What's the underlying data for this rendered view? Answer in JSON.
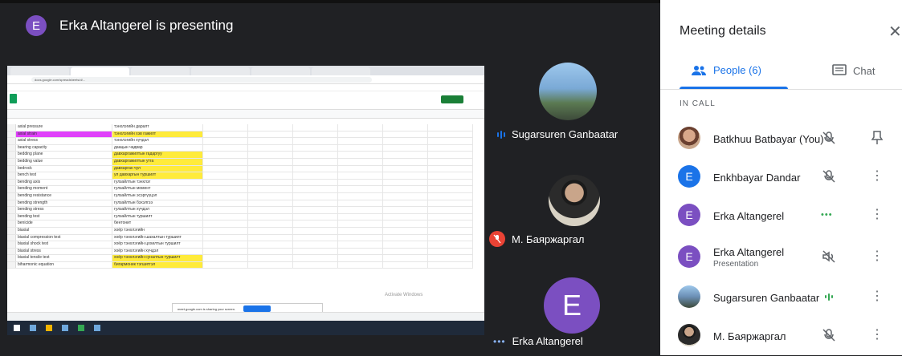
{
  "presenter": {
    "avatar_letter": "E",
    "text": "Erka Altangerel is presenting"
  },
  "tiles": [
    {
      "name": "Sugarsuren Ganbaatar"
    },
    {
      "name": "М. Баяржаргал"
    },
    {
      "name": "Erka Altangerel",
      "avatar_letter": "E"
    }
  ],
  "panel": {
    "title": "Meeting details",
    "tabs": {
      "people": "People (6)",
      "chat": "Chat"
    },
    "section": "IN CALL",
    "participants": [
      {
        "name": "Batkhuu Batbayar (You)",
        "sub": "",
        "avatar": "photo"
      },
      {
        "name": "Enkhbayar Dandar",
        "sub": "",
        "avatar_letter": "E",
        "color": "#1a73e8"
      },
      {
        "name": "Erka Altangerel",
        "sub": "",
        "avatar_letter": "E",
        "color": "#7b4fc1"
      },
      {
        "name": "Erka Altangerel",
        "sub": "Presentation",
        "avatar_letter": "E",
        "color": "#7b4fc1"
      },
      {
        "name": "Sugarsuren Ganbaatar",
        "sub": "",
        "avatar": "photo"
      },
      {
        "name": "М. Баяржаргал",
        "sub": "",
        "avatar": "photo"
      }
    ]
  },
  "shared_screen": {
    "url": "docs.google.com/spreadsheets/d/...",
    "sharebar_text": "meet.google.com is sharing your screen.",
    "rows": [
      {
        "a": "axial pressure",
        "b": "тэнхлэгийн даралт",
        "ya": false,
        "yb": false
      },
      {
        "a": "axial strain",
        "b": "тэнхлэгийн хэв гажилт",
        "ya": true,
        "yb": true
      },
      {
        "a": "axial stress",
        "b": "тэнхлэгийн хүчдэл",
        "ya": false,
        "yb": false
      },
      {
        "a": "bearing capacity",
        "b": "даацын чадвар",
        "ya": false,
        "yb": false
      },
      {
        "a": "bedding plane",
        "b": "давхаргажилтын гадаргуу",
        "ya": false,
        "yb": true
      },
      {
        "a": "bedding value",
        "b": "давхаргажилтын утга",
        "ya": false,
        "yb": true
      },
      {
        "a": "bedrock",
        "b": "давхарган чул",
        "ya": false,
        "yb": true
      },
      {
        "a": "bench test",
        "b": "ул давхаргын туршилт",
        "ya": false,
        "yb": true
      },
      {
        "a": "bending axis",
        "b": "гулзайлтын тэнхлэг",
        "ya": false,
        "yb": false
      },
      {
        "a": "bending moment",
        "b": "гулзайлтын момент",
        "ya": false,
        "yb": false
      },
      {
        "a": "bending resistance",
        "b": "гулзайлтын эсэргүүцэл",
        "ya": false,
        "yb": false
      },
      {
        "a": "bending strength",
        "b": "гулзайлтын бэхэлгээ",
        "ya": false,
        "yb": false
      },
      {
        "a": "bending stress",
        "b": "гулзайлтын хүчдэл",
        "ya": false,
        "yb": false
      },
      {
        "a": "bending test",
        "b": "гулзайлтын туршилт",
        "ya": false,
        "yb": false
      },
      {
        "a": "benicide",
        "b": "бентонит",
        "ya": false,
        "yb": false
      },
      {
        "a": "biaxial",
        "b": "хоёр тэнхлэгийн",
        "ya": false,
        "yb": false
      },
      {
        "a": "biaxial compression test",
        "b": "хоёр тэнхлэгийн шахалтын туршилт",
        "ya": false,
        "yb": false
      },
      {
        "a": "biaxial shock test",
        "b": "хоёр тэнхлэгийн цохилтын туршилт",
        "ya": false,
        "yb": false
      },
      {
        "a": "biaxial stress",
        "b": "хоёр тэнхлэгийн хүчдэл",
        "ya": false,
        "yb": false
      },
      {
        "a": "biaxial tensile test",
        "b": "хоёр тэнхлэгийн суналтын туршилт",
        "ya": false,
        "yb": true
      },
      {
        "a": "biharmonic equation",
        "b": "бигармоник тэгшитгэл",
        "ya": false,
        "yb": true
      }
    ]
  },
  "colors": {
    "accent": "#1a73e8",
    "purple": "#7b4fc1",
    "mic_off": "#ea4335",
    "speaking": "#34a853"
  }
}
